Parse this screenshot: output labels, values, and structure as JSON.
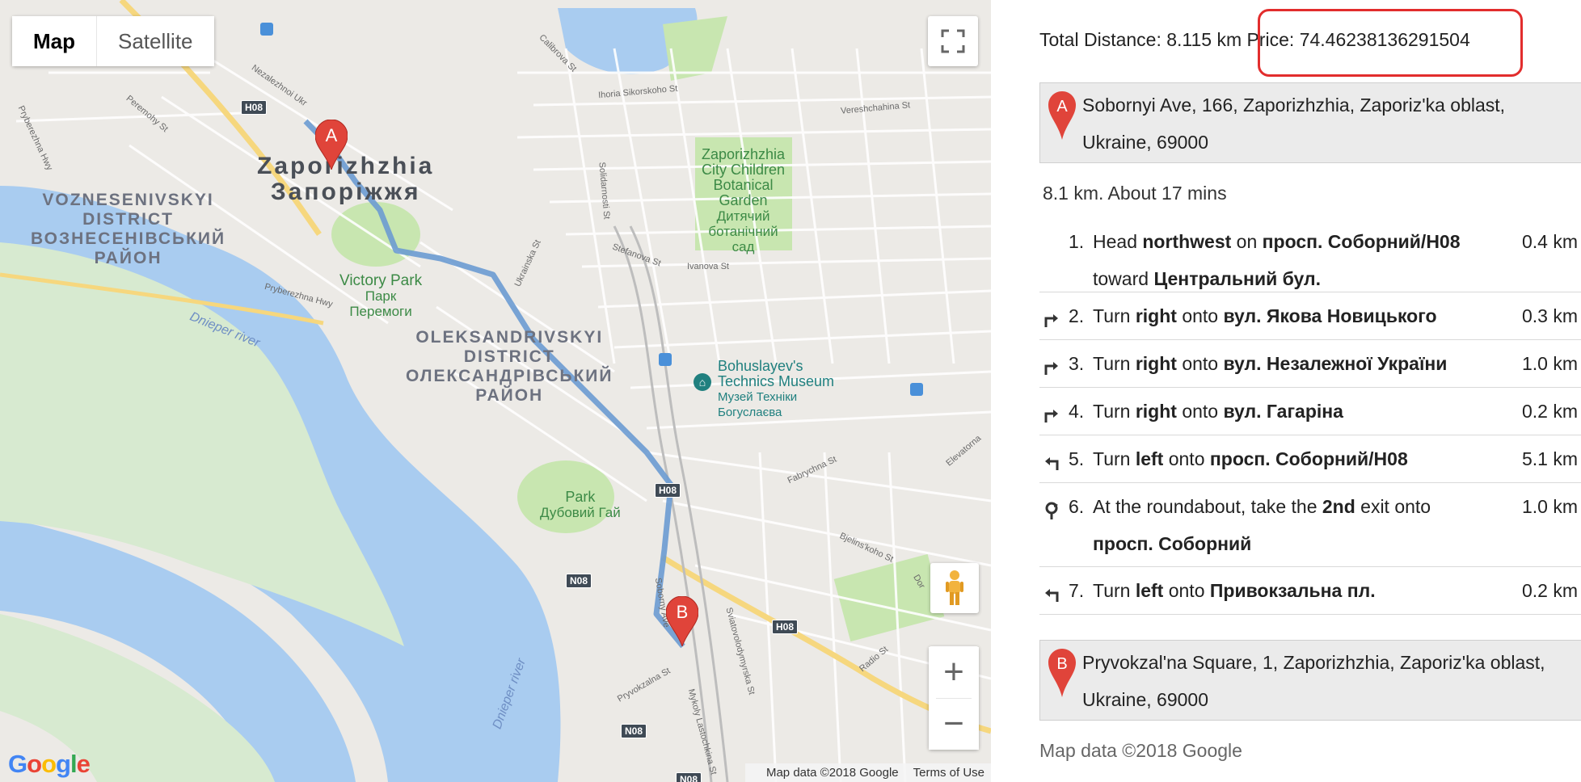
{
  "map": {
    "type_control": {
      "map_label": "Map",
      "satellite_label": "Satellite"
    },
    "city_label": {
      "latin": "Zaporizhzhia",
      "cyrillic": "Запоріжжя"
    },
    "districts": [
      {
        "lines": [
          "VOZNESENIVSKYI",
          "DISTRICT",
          "ВОЗНЕСЕНІВСЬКИЙ",
          "РАЙОН"
        ]
      },
      {
        "lines": [
          "OLEKSANDRIVSKYI",
          "DISTRICT",
          "ОЛЕКСАНДРІВСЬКИЙ",
          "РАЙОН"
        ]
      }
    ],
    "parks": [
      {
        "lines": [
          "Victory Park",
          "Парк",
          "Перемоги"
        ]
      },
      {
        "lines": [
          "Zaporizhzhia",
          "City Children",
          "Botanical",
          "Garden",
          "Дитячий",
          "ботанічний",
          "сад"
        ]
      },
      {
        "lines": [
          "Park",
          "Дубовий Гай"
        ]
      }
    ],
    "museum": {
      "lines": [
        "Bohuslayev's",
        "Technics Museum",
        "Музей Техніки",
        "Богуслаєва"
      ]
    },
    "rivers": [
      "Dnieper river",
      "Dnieper river"
    ],
    "streets": [
      "Nezalezhnoi Ukr",
      "Peremohy St",
      "Pryberezhna Hwy",
      "Calibrova St",
      "Ihoria Sikorskoho St",
      "Vereshchahina St",
      "Solidarnosti St",
      "Ukrainska St",
      "Stefanova St",
      "Ivanova St",
      "Pryberezhna Hwy",
      "Fabrychna St",
      "Bjelins'koho St",
      "Elevatorna",
      "Sviatovolodymyrska St",
      "Pryvokzalna St",
      "Mykoly Lastochkina St",
      "Radio St",
      "Soborny Ave",
      "Dor"
    ],
    "road_shields": [
      "H08",
      "H08",
      "N08",
      "H08",
      "N08",
      "N08"
    ],
    "markers": {
      "start": "A",
      "end": "B"
    },
    "logo": "Google",
    "footer": {
      "data": "Map data ©2018 Google",
      "terms": "Terms of Use"
    },
    "zoom_in": "+",
    "zoom_out": "−"
  },
  "directions": {
    "summary": "Total Distance: 8.115 km Price: 74.46238136291504",
    "origin": {
      "marker": "A",
      "address": "Sobornyi Ave, 166, Zaporizhzhia, Zaporiz'ka oblast, Ukraine, 69000"
    },
    "leg_summary": "8.1 km. About 17 mins",
    "steps": [
      {
        "num": "1.",
        "maneuver": "",
        "parts": [
          [
            "Head ",
            false
          ],
          [
            "northwest",
            true
          ],
          [
            " on ",
            false
          ],
          [
            "просп. Соборний/H08",
            true
          ],
          [
            " toward ",
            false
          ],
          [
            "Центральний бул.",
            true
          ]
        ],
        "dist": "0.4 km"
      },
      {
        "num": "2.",
        "maneuver": "turn-right-icon",
        "parts": [
          [
            "Turn ",
            false
          ],
          [
            "right",
            true
          ],
          [
            " onto ",
            false
          ],
          [
            "вул. Якова Новицького",
            true
          ]
        ],
        "dist": "0.3 km"
      },
      {
        "num": "3.",
        "maneuver": "turn-right-icon",
        "parts": [
          [
            "Turn ",
            false
          ],
          [
            "right",
            true
          ],
          [
            " onto ",
            false
          ],
          [
            "вул. Незалежної України",
            true
          ]
        ],
        "dist": "1.0 km"
      },
      {
        "num": "4.",
        "maneuver": "turn-right-icon",
        "parts": [
          [
            "Turn ",
            false
          ],
          [
            "right",
            true
          ],
          [
            " onto ",
            false
          ],
          [
            "вул. Гагаріна",
            true
          ]
        ],
        "dist": "0.2 km"
      },
      {
        "num": "5.",
        "maneuver": "turn-left-icon",
        "parts": [
          [
            "Turn ",
            false
          ],
          [
            "left",
            true
          ],
          [
            " onto ",
            false
          ],
          [
            "просп. Соборний/H08",
            true
          ]
        ],
        "dist": "5.1 km"
      },
      {
        "num": "6.",
        "maneuver": "roundabout-icon",
        "parts": [
          [
            "At the roundabout, take the ",
            false
          ],
          [
            "2nd",
            true
          ],
          [
            " exit onto ",
            false
          ],
          [
            "просп. Соборний",
            true
          ]
        ],
        "dist": "1.0 km"
      },
      {
        "num": "7.",
        "maneuver": "turn-left-icon",
        "parts": [
          [
            "Turn ",
            false
          ],
          [
            "left",
            true
          ],
          [
            " onto ",
            false
          ],
          [
            "Привокзальна пл.",
            true
          ]
        ],
        "dist": "0.2 km"
      }
    ],
    "destination": {
      "marker": "B",
      "address": "Pryvokzal'na Square, 1, Zaporizhzhia, Zaporiz'ka oblast, Ukraine, 69000"
    },
    "map_data": "Map data ©2018 Google"
  },
  "colors": {
    "route": "#6b9bd1",
    "marker": "#e0443a",
    "highlight": "#e22d2d",
    "water": "#a9ccf0",
    "park": "#c8e6b0"
  }
}
